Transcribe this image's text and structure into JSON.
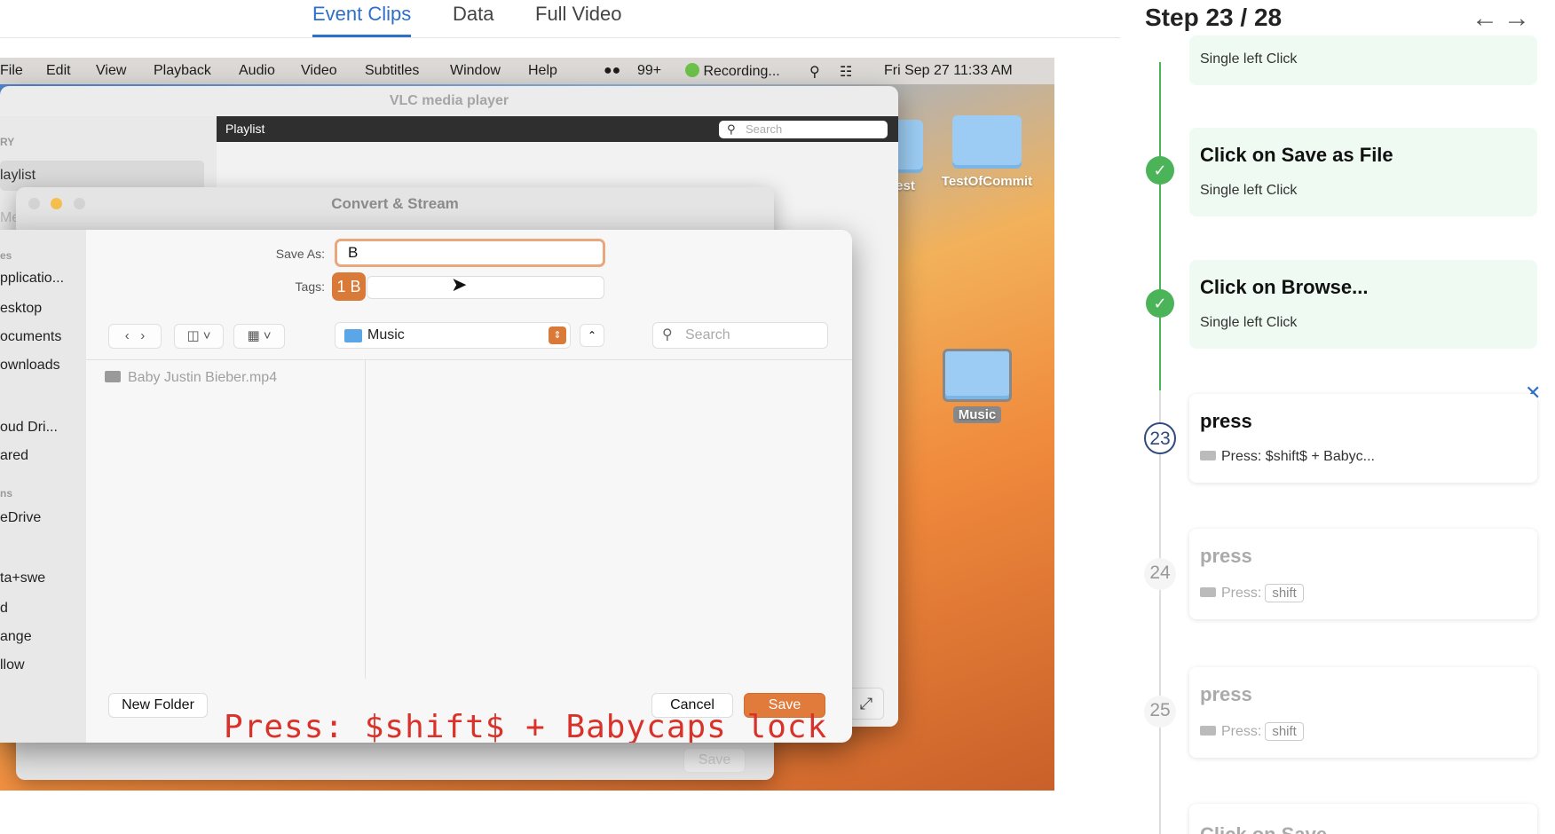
{
  "tabs": [
    "Event Clips",
    "Data",
    "Full Video"
  ],
  "menubar": {
    "items": [
      "File",
      "Edit",
      "View",
      "Playback",
      "Audio",
      "Video",
      "Subtitles",
      "Window",
      "Help"
    ],
    "notif": "99+",
    "recording": "Recording...",
    "datetime": "Fri Sep 27  11:33 AM"
  },
  "vlc": {
    "title": "VLC media player",
    "side_header": "RY",
    "side_item": "laylist",
    "side_item2": "Me",
    "playlist": "Playlist",
    "search_placeholder": "Search"
  },
  "convert": {
    "title": "Convert & Stream",
    "save_button": "Save"
  },
  "save_panel": {
    "save_as_label": "Save As:",
    "save_as_value": "B",
    "tags_label": "Tags:",
    "tag_chip": "1 B",
    "location": "Music",
    "search_placeholder": "Search",
    "file": "Baby Justin Bieber.mp4",
    "new_folder": "New Folder",
    "cancel": "Cancel",
    "save": "Save",
    "sidebar": [
      {
        "type": "h",
        "text": "es"
      },
      {
        "type": "i",
        "text": "pplicatio..."
      },
      {
        "type": "i",
        "text": "esktop"
      },
      {
        "type": "i",
        "text": "ocuments"
      },
      {
        "type": "i",
        "text": "ownloads"
      },
      {
        "type": "i",
        "text": "oud Dri..."
      },
      {
        "type": "i",
        "text": "ared"
      },
      {
        "type": "h",
        "text": "ns"
      },
      {
        "type": "i",
        "text": "eDrive"
      },
      {
        "type": "i",
        "text": "ta+swe"
      },
      {
        "type": "i",
        "text": "d"
      },
      {
        "type": "i",
        "text": "ange"
      },
      {
        "type": "i",
        "text": "llow"
      }
    ]
  },
  "overlay": "Press: $shift$ + Babycaps_lock",
  "desktop": {
    "icon1": "est",
    "icon2": "TestOfCommit",
    "icon3": "Music"
  },
  "right": {
    "step_title": "Step 23 / 28",
    "cards": [
      {
        "title": "",
        "sub": "Single left Click"
      },
      {
        "title": "Click on Save as File",
        "sub": "Single left Click"
      },
      {
        "title": "Click on Browse...",
        "sub": "Single left Click"
      },
      {
        "title": "press",
        "sub": "Press: $shift$ + Babyc...",
        "num": "23"
      },
      {
        "title": "press",
        "sub": "Press:",
        "key": "shift",
        "num": "24"
      },
      {
        "title": "press",
        "sub": "Press:",
        "key": "shift",
        "num": "25"
      },
      {
        "title": "Click on Save",
        "sub": ""
      }
    ]
  },
  "colors": {
    "accent": "#2f6fc9",
    "success": "#4cb458",
    "save_orange": "#e07b3c",
    "overlay_red": "#d8322a"
  }
}
